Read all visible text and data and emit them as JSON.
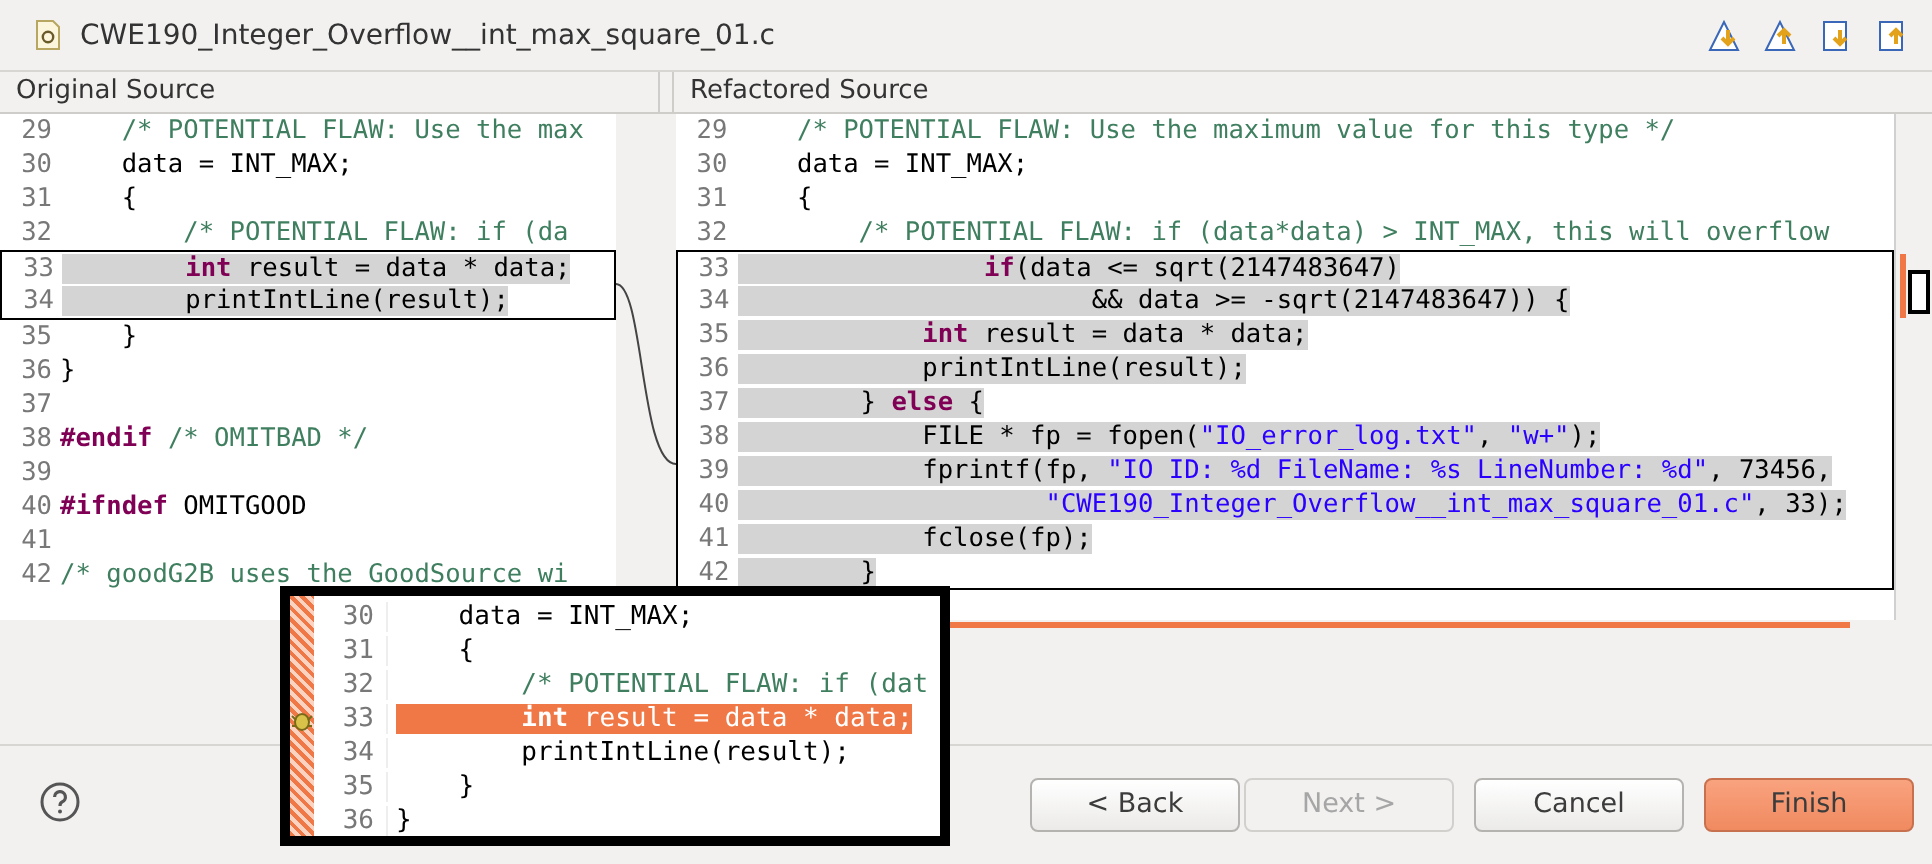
{
  "window": {
    "title": "CWE190_Integer_Overflow__int_max_square_01.c"
  },
  "toolbar": [
    {
      "kind": "next"
    },
    {
      "kind": "previous"
    },
    {
      "kind": "nextfile"
    },
    {
      "kind": "previousfile"
    }
  ],
  "panes": [
    {
      "title": "Original Source",
      "sections": [
        {
          "kind": "context",
          "lines": [
            {
              "n": "29",
              "tokens": [
                {
                  "kind": "comment",
                  "text": "    /* POTENTIAL FLAW: Use the max"
                }
              ]
            },
            {
              "n": "30",
              "tokens": [
                {
                  "kind": "plain",
                  "text": "    data = INT_MAX;"
                }
              ]
            },
            {
              "n": "31",
              "tokens": [
                {
                  "kind": "plain",
                  "text": "    {"
                }
              ]
            },
            {
              "n": "32",
              "tokens": [
                {
                  "kind": "comment",
                  "text": "        /* POTENTIAL FLAW: if (da"
                }
              ]
            }
          ]
        },
        {
          "kind": "change",
          "lines": [
            {
              "n": "33",
              "tokens": [
                {
                  "kind": "keyword",
                  "text": "        int"
                },
                {
                  "kind": "plain",
                  "text": " result = data * data;"
                }
              ]
            },
            {
              "n": "34",
              "tokens": [
                {
                  "kind": "plain",
                  "text": "        printIntLine(result);"
                }
              ]
            }
          ]
        },
        {
          "kind": "context",
          "lines": [
            {
              "n": "35",
              "tokens": [
                {
                  "kind": "plain",
                  "text": "    }"
                }
              ]
            },
            {
              "n": "36",
              "tokens": [
                {
                  "kind": "plain",
                  "text": "}"
                }
              ]
            },
            {
              "n": "37"
            },
            {
              "n": "38",
              "tokens": [
                {
                  "kind": "keyword",
                  "text": "#endif"
                },
                {
                  "kind": "comment",
                  "text": " /* OMITBAD */"
                }
              ]
            },
            {
              "n": "39"
            },
            {
              "n": "40",
              "tokens": [
                {
                  "kind": "keyword",
                  "text": "#ifndef"
                },
                {
                  "kind": "plain",
                  "text": " OMITGOOD"
                }
              ]
            },
            {
              "n": "41"
            },
            {
              "n": "42",
              "tokens": [
                {
                  "kind": "comment",
                  "text": "/* goodG2B uses the GoodSource wi"
                }
              ]
            }
          ]
        }
      ]
    },
    {
      "title": "Refactored Source",
      "sections": [
        {
          "kind": "context",
          "lines": [
            {
              "n": "29",
              "tokens": [
                {
                  "kind": "comment",
                  "text": "    /* POTENTIAL FLAW: Use the maximum value for this type */"
                }
              ]
            },
            {
              "n": "30",
              "tokens": [
                {
                  "kind": "plain",
                  "text": "    data = INT_MAX;"
                }
              ]
            },
            {
              "n": "31",
              "tokens": [
                {
                  "kind": "plain",
                  "text": "    {"
                }
              ]
            },
            {
              "n": "32",
              "tokens": [
                {
                  "kind": "comment",
                  "text": "        /* POTENTIAL FLAW: if (data*data) > INT_MAX, this will overflow"
                }
              ]
            }
          ]
        },
        {
          "kind": "change",
          "lines": [
            {
              "n": "33",
              "tokens": [
                {
                  "kind": "keyword",
                  "text": "                if"
                },
                {
                  "kind": "plain",
                  "text": "(data <= sqrt(2147483647)"
                }
              ]
            },
            {
              "n": "34",
              "tokens": [
                {
                  "kind": "plain",
                  "text": "                       && data >= -sqrt(2147483647)) {"
                }
              ]
            },
            {
              "n": "35",
              "tokens": [
                {
                  "kind": "keyword",
                  "text": "            int"
                },
                {
                  "kind": "plain",
                  "text": " result = data * data;"
                }
              ]
            },
            {
              "n": "36",
              "tokens": [
                {
                  "kind": "plain",
                  "text": "            printIntLine(result);"
                }
              ]
            },
            {
              "n": "37",
              "tokens": [
                {
                  "kind": "plain",
                  "text": "        } "
                },
                {
                  "kind": "keyword",
                  "text": "else"
                },
                {
                  "kind": "plain",
                  "text": " {"
                }
              ]
            },
            {
              "n": "38",
              "tokens": [
                {
                  "kind": "plain",
                  "text": "            FILE * fp = fopen("
                },
                {
                  "kind": "string",
                  "text": "\"IO_error_log.txt\""
                },
                {
                  "kind": "plain",
                  "text": ", "
                },
                {
                  "kind": "string",
                  "text": "\"w+\""
                },
                {
                  "kind": "plain",
                  "text": ");"
                }
              ]
            },
            {
              "n": "39",
              "tokens": [
                {
                  "kind": "plain",
                  "text": "            fprintf(fp, "
                },
                {
                  "kind": "string",
                  "text": "\"IO ID: %d FileName: %s LineNumber: %d\""
                },
                {
                  "kind": "plain",
                  "text": ", 73456,"
                }
              ]
            },
            {
              "n": "40",
              "tokens": [
                {
                  "kind": "string",
                  "text": "                    \"CWE190_Integer_Overflow__int_max_square_01.c\""
                },
                {
                  "kind": "plain",
                  "text": ", 33);"
                }
              ]
            },
            {
              "n": "41",
              "tokens": [
                {
                  "kind": "plain",
                  "text": "            fclose(fp);"
                }
              ]
            },
            {
              "n": "42",
              "tokens": [
                {
                  "kind": "plain",
                  "text": "        }"
                }
              ]
            }
          ]
        }
      ]
    }
  ],
  "popup": {
    "lines": [
      {
        "n": "30",
        "marked": false,
        "tokens": [
          {
            "kind": "plain",
            "text": "    data = INT_MAX;"
          }
        ]
      },
      {
        "n": "31",
        "marked": false,
        "tokens": [
          {
            "kind": "plain",
            "text": "    {"
          }
        ]
      },
      {
        "n": "32",
        "marked": false,
        "tokens": [
          {
            "kind": "comment",
            "text": "        /* POTENTIAL FLAW: if (dat"
          }
        ]
      },
      {
        "n": "33",
        "marked": true,
        "tokens": [
          {
            "kind": "keyword",
            "text": "        int"
          },
          {
            "kind": "plain",
            "text": " result = data * data;"
          }
        ]
      },
      {
        "n": "34",
        "marked": false,
        "tokens": [
          {
            "kind": "plain",
            "text": "        printIntLine(result);"
          }
        ]
      },
      {
        "n": "35",
        "marked": false,
        "tokens": [
          {
            "kind": "plain",
            "text": "    }"
          }
        ]
      },
      {
        "n": "36",
        "marked": false,
        "tokens": [
          {
            "kind": "plain",
            "text": "}"
          }
        ]
      }
    ]
  },
  "buttons": [
    {
      "label": "< Back",
      "disabled": false,
      "default": false
    },
    {
      "label": "Next >",
      "disabled": true,
      "default": false
    },
    {
      "label": "Cancel",
      "disabled": false,
      "default": false
    },
    {
      "label": "Finish",
      "disabled": false,
      "default": true
    }
  ]
}
